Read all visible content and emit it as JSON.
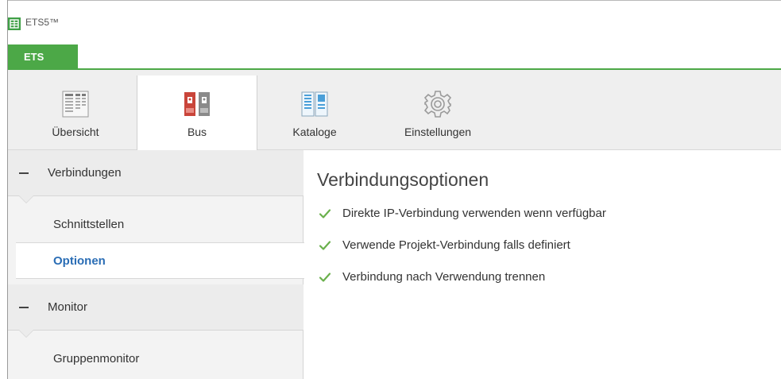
{
  "window": {
    "title": "ETS5™"
  },
  "app_tab": {
    "label": "ETS"
  },
  "ribbon": {
    "tabs": [
      {
        "label": "Übersicht",
        "icon": "overview-icon",
        "active": false
      },
      {
        "label": "Bus",
        "icon": "bus-icon",
        "active": true
      },
      {
        "label": "Kataloge",
        "icon": "catalog-icon",
        "active": false
      },
      {
        "label": "Einstellungen",
        "icon": "gear-icon",
        "active": false
      }
    ]
  },
  "sidebar": {
    "sections": [
      {
        "title": "Verbindungen",
        "items": [
          {
            "label": "Schnittstellen",
            "selected": false
          },
          {
            "label": "Optionen",
            "selected": true
          }
        ]
      },
      {
        "title": "Monitor",
        "items": [
          {
            "label": "Gruppenmonitor",
            "selected": false
          }
        ]
      }
    ]
  },
  "content": {
    "heading": "Verbindungsoptionen",
    "options": [
      {
        "label": "Direkte IP-Verbindung verwenden wenn verfügbar",
        "checked": true
      },
      {
        "label": "Verwende Projekt-Verbindung falls definiert",
        "checked": true
      },
      {
        "label": "Verbindung nach Verwendung trennen",
        "checked": true
      }
    ]
  },
  "colors": {
    "accent_green": "#4ca847",
    "selected_text_blue": "#2a6db5",
    "check_green": "#6ab04c"
  }
}
